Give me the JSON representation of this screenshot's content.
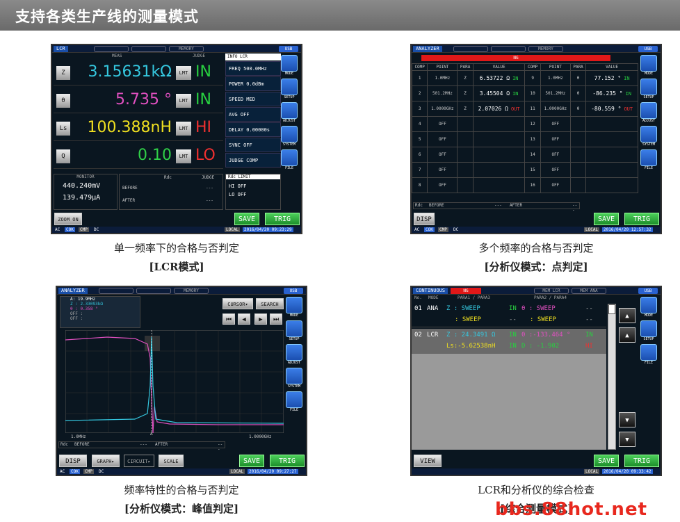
{
  "banner": {
    "title": "支持各类生产线的测量模式"
  },
  "p1": {
    "mode": "LCR",
    "tab_memory": "MEMORY",
    "usb": "USB",
    "meas_header": "MEAS",
    "judge_header": "JUDGE",
    "info_header": "INFO LCR",
    "rows": [
      {
        "label": "Z",
        "value": "3.15631kΩ",
        "lmt": "LMT",
        "judge": "IN",
        "color": "#35c8e0",
        "jcolor": "#28d040"
      },
      {
        "label": "θ",
        "value": "5.735 °",
        "lmt": "LMT",
        "judge": "IN",
        "color": "#e050c0",
        "jcolor": "#28d040"
      },
      {
        "label": "Ls",
        "value": "100.388nH",
        "lmt": "LMT",
        "judge": "HI",
        "color": "#f0e020",
        "jcolor": "#f03030"
      },
      {
        "label": "Q",
        "value": "0.10",
        "lmt": "LMT",
        "judge": "LO",
        "color": "#30d048",
        "jcolor": "#f03030"
      }
    ],
    "info": [
      "FREQ  500.0MHz",
      "POWER  0.0dBm",
      "SPEED  MED",
      "AVG  OFF",
      "DELAY  0.00000s",
      "SYNC  OFF",
      "JUDGE  COMP"
    ],
    "monitor_header": "MONITOR",
    "monitor": [
      "440.240mV",
      "139.479μA"
    ],
    "rdc_header": "Rdc",
    "rdc_judge": "JUDGE",
    "before": "BEFORE",
    "after": "AFTER",
    "dash": "---",
    "rdc_limit": "Rdc LIMIT",
    "hi": "HI  OFF",
    "lo": "LO  OFF",
    "zoom": "ZOOM ON",
    "save": "SAVE",
    "trig": "TRIG",
    "status": {
      "ac": "AC",
      "cok": "COK",
      "cmp": "CMP",
      "dc": "DC",
      "local": "LOCAL",
      "time": "2016/04/20 09:23:29"
    },
    "side": [
      "MODE",
      "SETUP",
      "ADJUST",
      "SYSTEM",
      "FILE"
    ]
  },
  "p2": {
    "mode": "ANALYZER",
    "tab_memory": "MEMORY",
    "usb": "USB",
    "ng": "NG",
    "headers": [
      "COMP",
      "POINT",
      "PARA",
      "VALUE",
      "COMP",
      "POINT",
      "PARA",
      "VALUE"
    ],
    "rows": [
      [
        "1",
        "1.0MHz",
        "Z",
        "6.53722 Ω",
        "IN",
        "9",
        "1.0MHz",
        "θ",
        "77.152 °",
        "IN"
      ],
      [
        "2",
        "501.2MHz",
        "Z",
        "3.45504 Ω",
        "IN",
        "10",
        "501.2MHz",
        "θ",
        "-86.235 °",
        "IN"
      ],
      [
        "3",
        "1.0000GHz",
        "Z",
        "2.07026 Ω",
        "OUT",
        "11",
        "1.0000GHz",
        "θ",
        "-80.559 °",
        "OUT"
      ],
      [
        "4",
        "OFF",
        "",
        "",
        "",
        "12",
        "OFF",
        "",
        "",
        ""
      ],
      [
        "5",
        "OFF",
        "",
        "",
        "",
        "13",
        "OFF",
        "",
        "",
        ""
      ],
      [
        "6",
        "OFF",
        "",
        "",
        "",
        "14",
        "OFF",
        "",
        "",
        ""
      ],
      [
        "7",
        "OFF",
        "",
        "",
        "",
        "15",
        "OFF",
        "",
        "",
        ""
      ],
      [
        "8",
        "OFF",
        "",
        "",
        "",
        "16",
        "OFF",
        "",
        "",
        ""
      ]
    ],
    "rdc": "Rdc",
    "before": "BEFORE",
    "after": "AFTER",
    "dash": "---",
    "disp": "DISP",
    "save": "SAVE",
    "trig": "TRIG",
    "status": {
      "ac": "AC",
      "cok": "COK",
      "cmp": "CMP",
      "dc": "DC",
      "local": "LOCAL",
      "time": "2016/04/20 12:57:32"
    },
    "side": [
      "MODE",
      "SETUP",
      "ADJUST",
      "SYSTEM",
      "FILE"
    ]
  },
  "p3": {
    "mode": "ANALYZER",
    "tab_memory": "MEMORY",
    "usb": "USB",
    "marker": [
      "A: 19.9MHz",
      "Z : 2.33093kΩ",
      "θ : 0.358 °",
      "OFF :",
      "OFF :"
    ],
    "cursor": "CURSOR▾",
    "search": "SEARCH",
    "xstart": "1.0MHz",
    "xend": "1.0000GHz",
    "amark": "A",
    "rdc": "Rdc",
    "before": "BEFORE",
    "after": "AFTER",
    "dash": "---",
    "disp": "DISP",
    "graph": "GRAPH▸",
    "circuit": "CIRCUIT▸",
    "scale": "SCALE",
    "save": "SAVE",
    "trig": "TRIG",
    "status": {
      "ac": "AC",
      "cok": "COK",
      "cmp": "CMP",
      "dc": "DC",
      "local": "LOCAL",
      "time": "2016/04/20 09:27:27"
    },
    "side": [
      "MODE",
      "SETUP",
      "ADJUST",
      "SYSTEM",
      "FILE"
    ]
  },
  "p4": {
    "mode": "CONTINUOUS",
    "ng": "NG",
    "tab1": "MEM LCR",
    "tab2": "MEM ANA",
    "usb": "USB",
    "headers": [
      "No.",
      "MODE",
      "PARA1 / PARA3",
      "PARA2 / PARA4"
    ],
    "r1": {
      "no": "01",
      "mode": "ANA",
      "a": "Z : SWEEP",
      "aj": "IN",
      "b": "θ : SWEEP",
      "bj": "--",
      "c": ": SWEEP",
      "cj": "--",
      "d": ": SWEEP",
      "dj": "--"
    },
    "r2": {
      "no": "02",
      "mode": "LCR",
      "a": "Z : 24.3491 Ω",
      "aj": "IN",
      "b": "θ :-133.464 °",
      "bj": "IN",
      "c": "Ls:-5.62538nH",
      "cj": "IN",
      "d": "D : -1.902",
      "dj": "HI"
    },
    "view": "VIEW",
    "save": "SAVE",
    "trig": "TRIG",
    "status": {
      "local": "LOCAL",
      "time": "2016/04/20 09:33:42"
    },
    "side": [
      "MODE",
      "SETUP",
      "FILE"
    ]
  },
  "captions": [
    {
      "l1": "单一频率下的合格与否判定",
      "l2": "[LCR模式]"
    },
    {
      "l1": "多个频率的合格与否判定",
      "l2": "[分析仪模式：点判定]"
    },
    {
      "l1": "频率特性的合格与否判定",
      "l2": "[分析仪模式：峰值判定]"
    },
    {
      "l1": "LCR和分析仪的综合检查",
      "l2": "[综合测量模式]"
    }
  ],
  "watermark": "bbs.88hot.net"
}
